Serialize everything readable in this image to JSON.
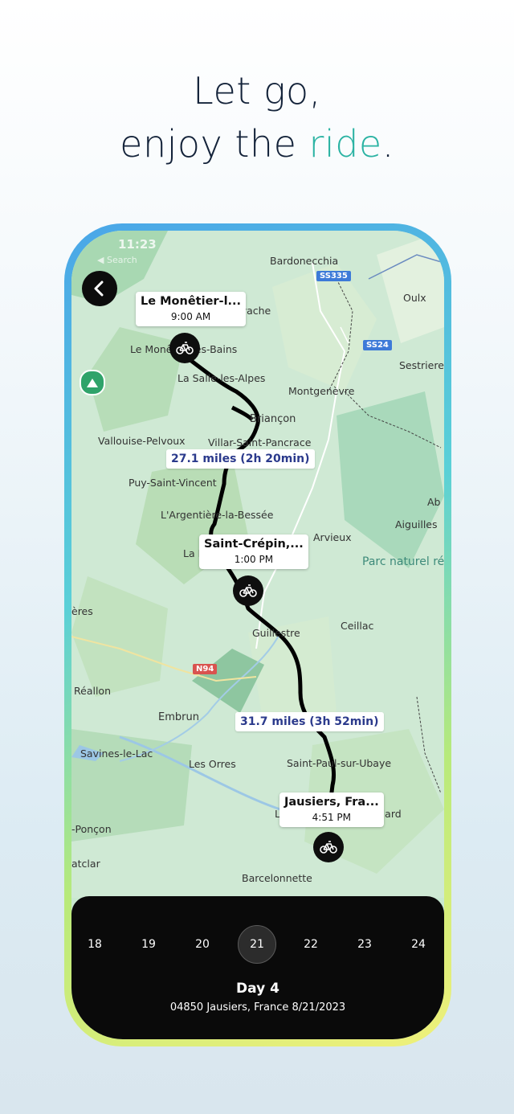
{
  "headline": {
    "line1": "Let go,",
    "line2_prefix": "enjoy the ",
    "line2_accent": "ride",
    "line2_suffix": "."
  },
  "status": {
    "time": "11:23",
    "sub": "◀ Search"
  },
  "map": {
    "labels": {
      "bardonecchia": "Bardonecchia",
      "oulx": "Oulx",
      "sestriere": "Sestriere",
      "evache": "évache",
      "le_monetier": "Le Monêtier-les-Bains",
      "la_salle": "La Salle-les-Alpes",
      "montgenevre": "Montgenèvre",
      "briancon": "Briançon",
      "vallouise": "Vallouise-Pelvoux",
      "villar": "Villar-Saint-Pancrace",
      "puy": "Puy-Saint-Vincent",
      "argentiere": "L'Argentière-la-Bessée",
      "ab": "Ab",
      "aiguilles": "Aiguilles",
      "arvieux": "Arvieux",
      "park": "Parc naturel régional du Queyras",
      "la_r": "La R",
      "eres": "ères",
      "guillestre": "Guillestre",
      "ceillac": "Ceillac",
      "reallon": "Réallon",
      "embrun": "Embrun",
      "savines": "Savines-le-Lac",
      "les_orres": "Les Orres",
      "saint_paul": "Saint-Paul-sur-Ubaye",
      "la": "La",
      "elard": "elard",
      "poncon": "-Ponçon",
      "atclar": "atclar",
      "barcelonnette": "Barcelonnette",
      "jausiers_map": "Jausiers"
    },
    "roads": {
      "ss335": "SS335",
      "ss24": "SS24",
      "n94": "N94"
    },
    "stops": [
      {
        "name": "Le Monêtier-l...",
        "time": "9:00 AM"
      },
      {
        "name": "Saint-Crépin,...",
        "time": "1:00 PM"
      },
      {
        "name": "Jausiers, Fra...",
        "time": "4:51 PM"
      }
    ],
    "legs": [
      "27.1 miles (2h 20min)",
      "31.7 miles (3h 52min)"
    ]
  },
  "days": [
    "18",
    "19",
    "20",
    "21",
    "22",
    "23",
    "24"
  ],
  "selected_day": "21",
  "day_info": {
    "title": "Day 4",
    "subtitle": "04850 Jausiers, France 8/21/2023"
  },
  "colors": {
    "accent": "#2bb3a3",
    "route": "#000000",
    "panel": "#0a0a0a"
  }
}
